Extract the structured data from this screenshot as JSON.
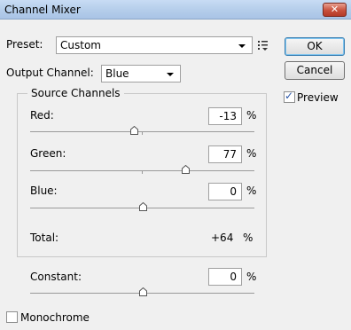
{
  "window": {
    "title": "Channel Mixer",
    "close_glyph": "✕"
  },
  "preset": {
    "label": "Preset:",
    "value": "Custom"
  },
  "output_channel": {
    "label": "Output Channel:",
    "value": "Blue"
  },
  "buttons": {
    "ok": "OK",
    "cancel": "Cancel"
  },
  "preview": {
    "label": "Preview",
    "checked": true
  },
  "source_channels": {
    "legend": "Source Channels",
    "percent_sign": "%",
    "channels": [
      {
        "label": "Red:",
        "value": "-13",
        "level": -13
      },
      {
        "label": "Green:",
        "value": "77",
        "level": 77
      },
      {
        "label": "Blue:",
        "value": "0",
        "level": 0
      }
    ],
    "total": {
      "label": "Total:",
      "value": "+64",
      "unit": "%"
    }
  },
  "constant": {
    "label": "Constant:",
    "value": "0",
    "unit": "%",
    "level": 0
  },
  "monochrome": {
    "label": "Monochrome",
    "checked": false
  },
  "colors": {
    "title_bar": "#b4cdea",
    "close_button": "#c8503c",
    "check_mark": "#2a56a8",
    "ok_border": "#3c7fb1"
  },
  "icons": {
    "close": "close-icon",
    "preset_menu": "preset-options-icon",
    "dropdown": "chevron-down-icon",
    "slider": "slider-thumb-icon"
  }
}
